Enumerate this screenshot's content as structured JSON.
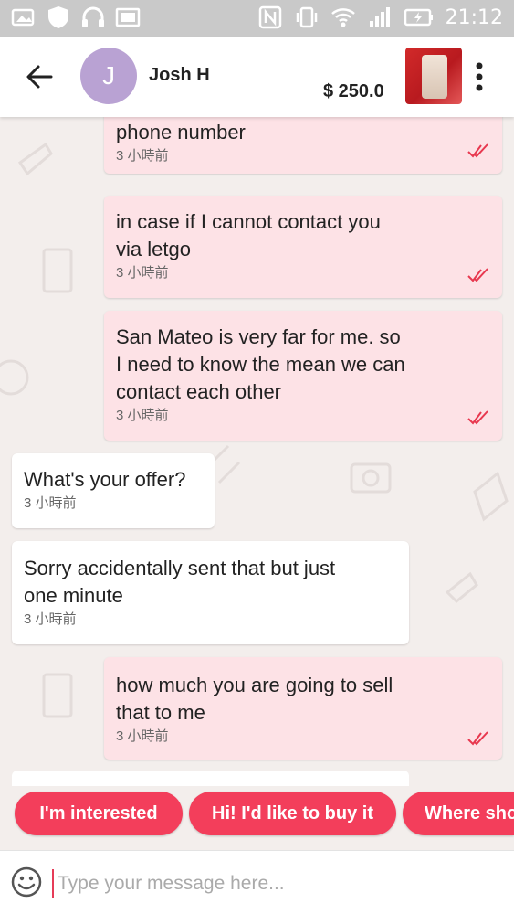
{
  "status_bar": {
    "time": "21:12"
  },
  "header": {
    "avatar_letter": "J",
    "contact_name": "Josh H",
    "price": "$ 250.0"
  },
  "messages": [
    {
      "direction": "out",
      "text": "phone number",
      "time": "3 小時前",
      "read": true
    },
    {
      "direction": "out",
      "text": "in case if I cannot contact you\nvia letgo",
      "time": "3 小時前",
      "read": true
    },
    {
      "direction": "out",
      "text": "San Mateo is very far for me. so\nI need to know the mean we can\ncontact each other",
      "time": "3 小時前",
      "read": true
    },
    {
      "direction": "in",
      "text": "What's your offer?",
      "time": "3 小時前"
    },
    {
      "direction": "in",
      "text": "Sorry accidentally sent that but just\none minute",
      "time": "3 小時前"
    },
    {
      "direction": "out",
      "text": "how much you are going to sell\nthat to me",
      "time": "3 小時前",
      "read": true
    }
  ],
  "quick_replies": [
    "I'm interested",
    "Hi! I'd like to buy it",
    "Where should we meet?"
  ],
  "composer": {
    "placeholder": "Type your message here..."
  },
  "colors": {
    "accent": "#f33e5b",
    "outgoing_bubble": "#fde2e6",
    "incoming_bubble": "#ffffff",
    "avatar": "#b9a2d3",
    "read_check": "#e8384f"
  }
}
